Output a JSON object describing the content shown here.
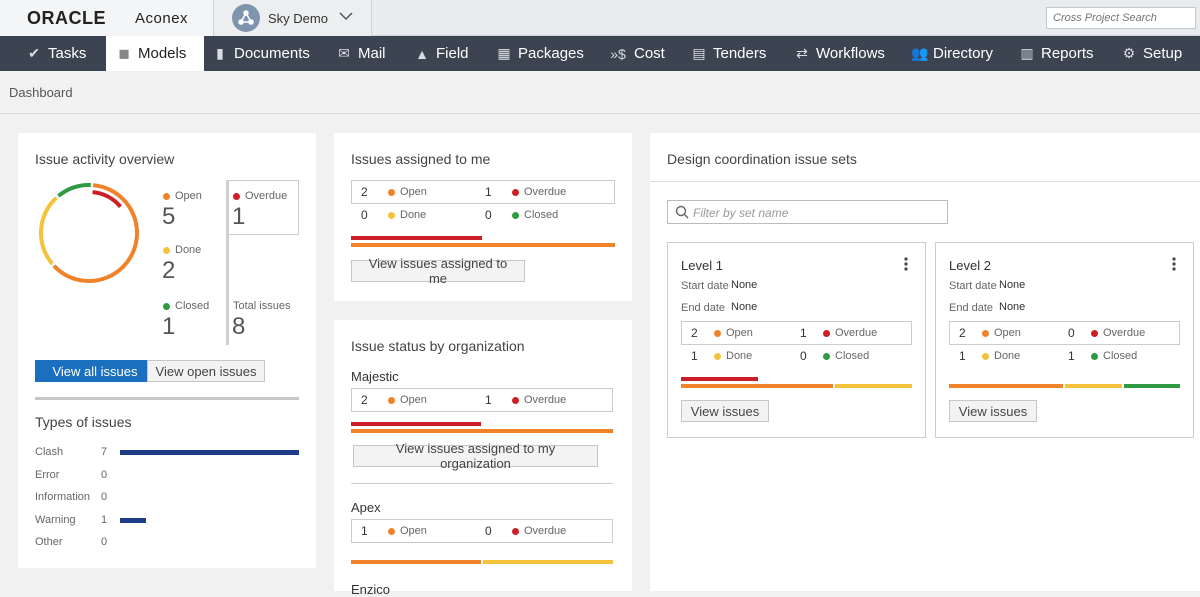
{
  "brand": {
    "oracle": "ORACLE",
    "aconex": "Aconex"
  },
  "project": {
    "name": "Sky Demo"
  },
  "search": {
    "placeholder": "Cross Project Search"
  },
  "nav": [
    "Tasks",
    "Models",
    "Documents",
    "Mail",
    "Field",
    "Packages",
    "Cost",
    "Tenders",
    "Workflows",
    "Directory",
    "Reports",
    "Setup"
  ],
  "breadcrumb": "Dashboard",
  "activity": {
    "title": "Issue activity overview",
    "open_label": "Open",
    "open": "5",
    "done_label": "Done",
    "done": "2",
    "closed_label": "Closed",
    "closed": "1",
    "overdue_label": "Overdue",
    "overdue": "1",
    "total_label": "Total issues",
    "total": "8",
    "view_all": "View all issues",
    "view_open": "View open issues"
  },
  "types": {
    "title": "Types of issues",
    "items": [
      {
        "name": "Clash",
        "count": "7",
        "fraction": 1.0
      },
      {
        "name": "Error",
        "count": "0",
        "fraction": 0
      },
      {
        "name": "Information",
        "count": "0",
        "fraction": 0
      },
      {
        "name": "Warning",
        "count": "1",
        "fraction": 0.143
      },
      {
        "name": "Other",
        "count": "0",
        "fraction": 0
      }
    ]
  },
  "assigned": {
    "title": "Issues assigned to me",
    "open_count": "2",
    "open_label": "Open",
    "overdue_count": "1",
    "overdue_label": "Overdue",
    "done_count": "0",
    "done_label": "Done",
    "closed_count": "0",
    "closed_label": "Closed",
    "button": "View issues assigned to me"
  },
  "org": {
    "title": "Issue status by organization",
    "majestic": {
      "name": "Majestic",
      "open_count": "2",
      "open_label": "Open",
      "overdue_count": "1",
      "overdue_label": "Overdue",
      "button": "View issues assigned to my organization"
    },
    "apex": {
      "name": "Apex",
      "open_count": "1",
      "open_label": "Open",
      "overdue_count": "0",
      "overdue_label": "Overdue"
    },
    "next_name": "Enzico"
  },
  "coord": {
    "title": "Design coordination issue sets",
    "filter_placeholder": "Filter by set name",
    "sets": [
      {
        "name": "Level 1",
        "start_label": "Start date",
        "start": "None",
        "end_label": "End date",
        "end": "None",
        "open_count": "2",
        "open_label": "Open",
        "overdue_count": "1",
        "overdue_label": "Overdue",
        "done_count": "1",
        "done_label": "Done",
        "closed_count": "0",
        "closed_label": "Closed",
        "button": "View issues"
      },
      {
        "name": "Level 2",
        "start_label": "Start date",
        "start": "None",
        "end_label": "End date",
        "end": "None",
        "open_count": "2",
        "open_label": "Open",
        "overdue_count": "0",
        "overdue_label": "Overdue",
        "done_count": "1",
        "done_label": "Done",
        "closed_count": "1",
        "closed_label": "Closed",
        "button": "View issues"
      }
    ]
  },
  "colors": {
    "open": "#f0832a",
    "done": "#f5c23b",
    "closed": "#2e9b43",
    "overdue": "#cc1e26",
    "primary": "#1a6fbf",
    "nav": "#3c4452",
    "types_bar": "#1f3c88"
  }
}
